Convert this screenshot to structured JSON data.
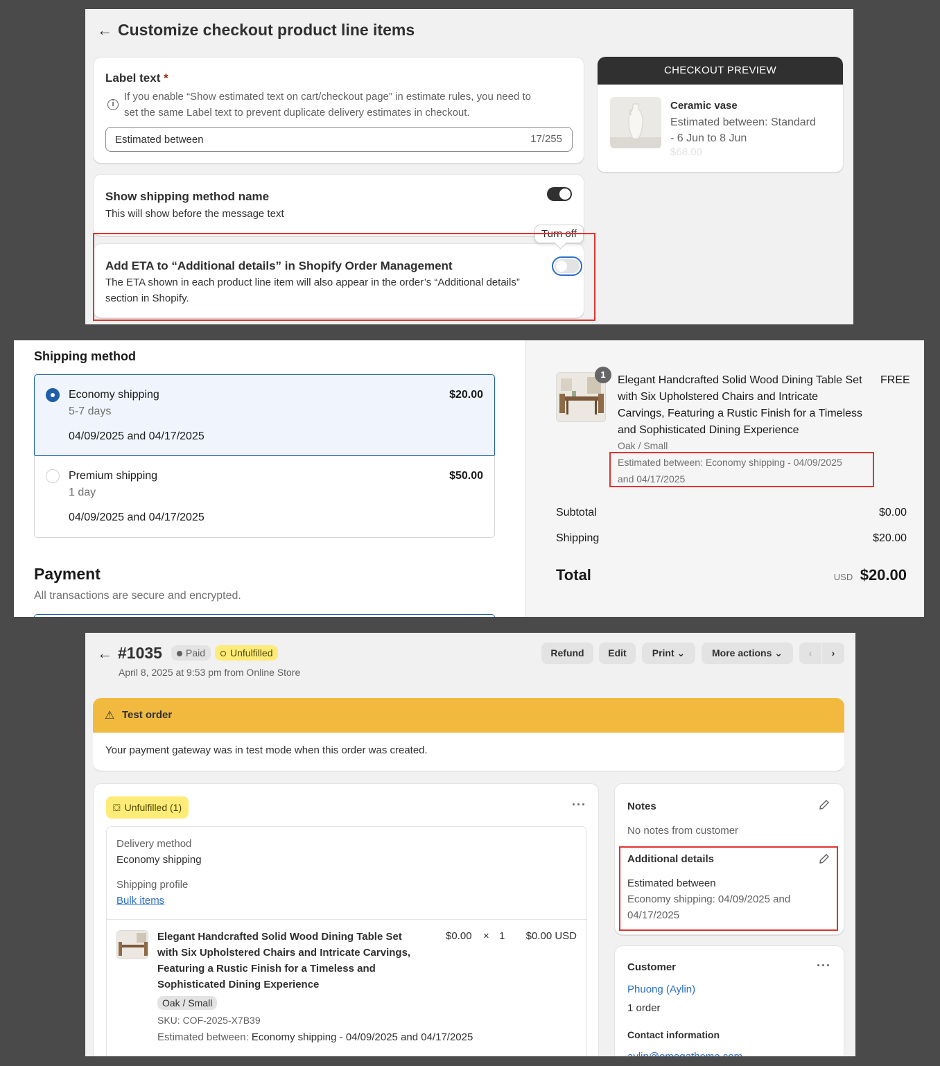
{
  "customize": {
    "back_icon": "arrow-left-icon",
    "title": "Customize checkout product line items",
    "label_text": {
      "heading": "Label text",
      "required_mark": "*",
      "info_line1": "If you enable “Show estimated text on cart/checkout page” in estimate rules, you need to",
      "info_line2": "set the same Label text to prevent duplicate delivery estimates in checkout.",
      "value": "Estimated between",
      "counter": "17/255"
    },
    "show_method": {
      "heading": "Show shipping method name",
      "desc": "This will show before the message text",
      "toggle_on": true
    },
    "eta": {
      "tooltip": "Turn off",
      "heading": "Add ETA to “Additional details” in Shopify Order Management",
      "desc_line1": "The ETA shown in each product line item will also appear in the order’s “Additional details”",
      "desc_line2": "section in Shopify.",
      "toggle_on": false
    },
    "preview": {
      "header": "CHECKOUT PREVIEW",
      "product": "Ceramic vase",
      "est_line1": "Estimated between: Standard",
      "est_line2": "- 6 Jun to 8 Jun",
      "price": "$68.00"
    }
  },
  "checkout": {
    "shipping_heading": "Shipping method",
    "options": [
      {
        "name": "Economy shipping",
        "days": "5-7 days",
        "dates": "04/09/2025 and 04/17/2025",
        "price": "$20.00",
        "selected": true
      },
      {
        "name": "Premium shipping",
        "days": "1 day",
        "dates": "04/09/2025 and 04/17/2025",
        "price": "$50.00",
        "selected": false
      }
    ],
    "payment_heading": "Payment",
    "payment_desc": "All transactions are secure and encrypted.",
    "summary": {
      "qty_badge": "1",
      "product_lines": [
        "Elegant Handcrafted Solid Wood Dining Table Set",
        "with Six Upholstered Chairs and Intricate",
        "Carvings, Featuring a Rustic Finish for a Timeless",
        "and Sophisticated Dining Experience"
      ],
      "product_price": "FREE",
      "variant": "Oak / Small",
      "est_line1": "Estimated between: Economy shipping - 04/09/2025",
      "est_line2": "and 04/17/2025",
      "subtotal_label": "Subtotal",
      "subtotal_value": "$0.00",
      "shipping_label": "Shipping",
      "shipping_value": "$20.00",
      "total_label": "Total",
      "currency": "USD",
      "total_value": "$20.00"
    }
  },
  "order": {
    "number": "#1035",
    "paid_badge": "Paid",
    "unfulfilled_badge": "Unfulfilled",
    "subtitle": "April 8, 2025 at 9:53 pm from Online Store",
    "buttons": {
      "refund": "Refund",
      "edit": "Edit",
      "print": "Print",
      "more": "More actions"
    },
    "test_title": "Test order",
    "test_desc": "Your payment gateway was in test mode when this order was created.",
    "fulfill": {
      "badge": "Unfulfilled (1)",
      "delivery_label": "Delivery method",
      "delivery_value": "Economy shipping",
      "profile_label": "Shipping profile",
      "profile_link": "Bulk items",
      "item_lines": [
        "Elegant Handcrafted Solid Wood Dining Table Set",
        "with Six Upholstered Chairs and Intricate Carvings,",
        "Featuring a Rustic Finish for a Timeless and",
        "Sophisticated Dining Experience"
      ],
      "unit_price": "$0.00",
      "times": "×",
      "qty": "1",
      "line_total": "$0.00 USD",
      "variant": "Oak / Small",
      "sku": "SKU: COF-2025-X7B39",
      "est_label": "Estimated between:",
      "est_value": "Economy shipping - 04/09/2025 and 04/17/2025"
    },
    "notes": {
      "heading": "Notes",
      "text": "No notes from customer",
      "add_heading": "Additional details",
      "add_line1": "Estimated between",
      "add_line2": "Economy shipping: 04/09/2025 and",
      "add_line3": "04/17/2025"
    },
    "customer": {
      "heading": "Customer",
      "name": "Phuong (Aylin)",
      "orders": "1 order",
      "contact_heading": "Contact information",
      "email": "aylin@omegatheme.com"
    }
  },
  "colors": {
    "accent": "#2c6ecb",
    "highlight": "#e3322f",
    "warning": "#f1ba3f",
    "dark": "#303030"
  }
}
